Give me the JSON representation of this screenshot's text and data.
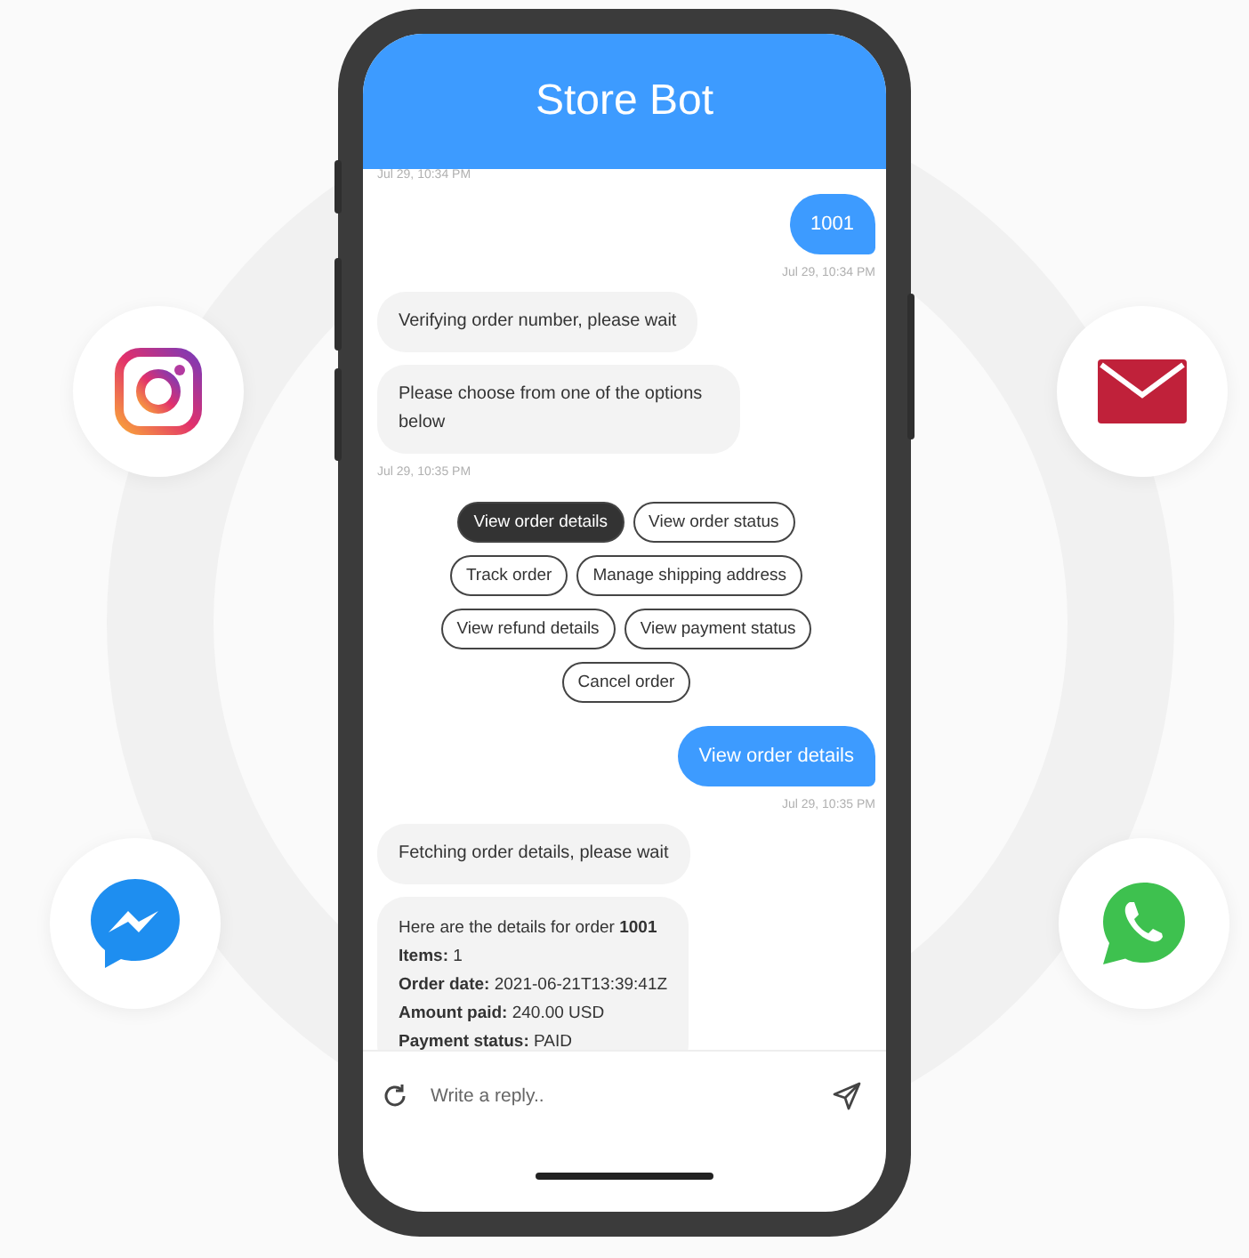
{
  "header": {
    "title": "Store Bot"
  },
  "messages": [
    {
      "kind": "timestamp",
      "outgoing": false,
      "text": "Jul 29, 10:34 PM"
    },
    {
      "kind": "bubble",
      "outgoing": true,
      "text": "1001"
    },
    {
      "kind": "timestamp",
      "outgoing": true,
      "text": "Jul 29, 10:34 PM"
    },
    {
      "kind": "bubble",
      "outgoing": false,
      "text": "Verifying order number, please wait"
    },
    {
      "kind": "bubble",
      "outgoing": false,
      "text": "Please choose from one of the options below"
    },
    {
      "kind": "timestamp",
      "outgoing": false,
      "text": "Jul 29, 10:35 PM"
    },
    {
      "kind": "options",
      "options": [
        {
          "label": "View order details",
          "selected": true
        },
        {
          "label": "View order status",
          "selected": false
        },
        {
          "label": "Track order",
          "selected": false
        },
        {
          "label": "Manage shipping address",
          "selected": false
        },
        {
          "label": "View refund details",
          "selected": false
        },
        {
          "label": "View payment status",
          "selected": false
        },
        {
          "label": "Cancel order",
          "selected": false
        }
      ]
    },
    {
      "kind": "bubble",
      "outgoing": true,
      "text": "View order details"
    },
    {
      "kind": "timestamp",
      "outgoing": true,
      "text": "Jul 29, 10:35 PM"
    },
    {
      "kind": "bubble",
      "outgoing": false,
      "text": "Fetching order details, please wait"
    },
    {
      "kind": "details",
      "lines": [
        "Here are the details for order **1001**",
        "**Items:** 1",
        "**Order date:** 2021-06-21T13:39:41Z",
        "**Amount paid:** 240.00 USD",
        "**Payment status:** PAID"
      ]
    }
  ],
  "composer": {
    "placeholder": "Write a reply.."
  }
}
